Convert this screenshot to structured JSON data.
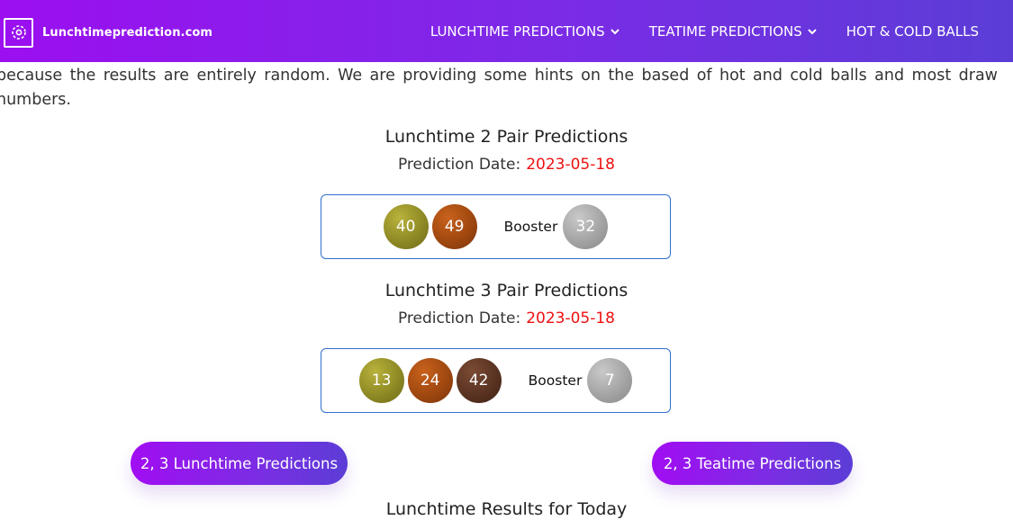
{
  "nav": {
    "brand": "Lunchtimeprediction.com",
    "logo_icon": "target-icon",
    "items": [
      {
        "label": "LUNCHTIME PREDICTIONS",
        "has_dropdown": true
      },
      {
        "label": "TEATIME PREDICTIONS",
        "has_dropdown": true
      },
      {
        "label": "HOT & COLD BALLS",
        "has_dropdown": false
      }
    ]
  },
  "intro_text": "because the results are entirely random. We are providing some hints on the based of hot and cold balls and most draw numbers.",
  "predictions": [
    {
      "title": "Lunchtime 2 Pair Predictions",
      "date_label": "Prediction Date:",
      "date": "2023-05-18",
      "balls": [
        {
          "value": "40",
          "color": "olive"
        },
        {
          "value": "49",
          "color": "orange"
        }
      ],
      "booster_label": "Booster",
      "booster": {
        "value": "32",
        "color": "grey"
      }
    },
    {
      "title": "Lunchtime 3 Pair Predictions",
      "date_label": "Prediction Date:",
      "date": "2023-05-18",
      "balls": [
        {
          "value": "13",
          "color": "olive"
        },
        {
          "value": "24",
          "color": "orange"
        },
        {
          "value": "42",
          "color": "brown"
        }
      ],
      "booster_label": "Booster",
      "booster": {
        "value": "7",
        "color": "grey"
      }
    }
  ],
  "buttons": {
    "lunchtime": "2, 3 Lunchtime Predictions",
    "teatime": "2, 3 Teatime Predictions"
  },
  "results_title": "Lunchtime Results for Today",
  "colors": {
    "nav_gradient_start": "#9b0ff0",
    "nav_gradient_end": "#5b3dd6",
    "date_red": "#ee1111",
    "box_border": "#2f6fcf"
  }
}
